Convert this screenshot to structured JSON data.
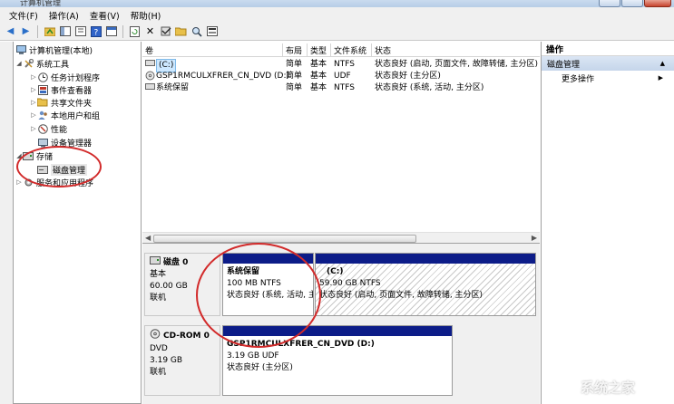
{
  "window": {
    "title": "计算机管理"
  },
  "menu": [
    "文件(F)",
    "操作(A)",
    "查看(V)",
    "帮助(H)"
  ],
  "tree": {
    "root": "计算机管理(本地)",
    "system_tools": "系统工具",
    "task_scheduler": "任务计划程序",
    "event_viewer": "事件查看器",
    "shared_folders": "共享文件夹",
    "local_users": "本地用户和组",
    "performance": "性能",
    "device_manager": "设备管理器",
    "storage": "存储",
    "disk_management": "磁盘管理",
    "services": "服务和应用程序"
  },
  "table": {
    "headers": [
      "卷",
      "布局",
      "类型",
      "文件系统",
      "状态"
    ],
    "rows": [
      {
        "volume": "(C:)",
        "layout": "简单",
        "type": "基本",
        "fs": "NTFS",
        "status": "状态良好 (启动, 页面文件, 故障转储, 主分区)"
      },
      {
        "volume": "GSP1RMCULXFRER_CN_DVD (D:)",
        "layout": "简单",
        "type": "基本",
        "fs": "UDF",
        "status": "状态良好 (主分区)"
      },
      {
        "volume": "系统保留",
        "layout": "简单",
        "type": "基本",
        "fs": "NTFS",
        "status": "状态良好 (系统, 活动, 主分区)"
      }
    ]
  },
  "disk0": {
    "name": "磁盘 0",
    "type": "基本",
    "size": "60.00 GB",
    "state": "联机",
    "p1": {
      "name": "系统保留",
      "size": "100 MB NTFS",
      "status": "状态良好 (系统, 活动, 主"
    },
    "p2": {
      "name": "(C:)",
      "size": "59.90 GB NTFS",
      "status": "状态良好 (启动, 页面文件, 故障转储, 主分区)"
    }
  },
  "cdrom0": {
    "name": "CD-ROM 0",
    "type": "DVD",
    "size": "3.19 GB",
    "state": "联机",
    "p1": {
      "name": "GSP1RMCULXFRER_CN_DVD  (D:)",
      "size": "3.19 GB UDF",
      "status": "状态良好 (主分区)"
    }
  },
  "actions": {
    "header": "操作",
    "section": "磁盘管理",
    "more": "更多操作"
  },
  "watermark": "系统之家"
}
